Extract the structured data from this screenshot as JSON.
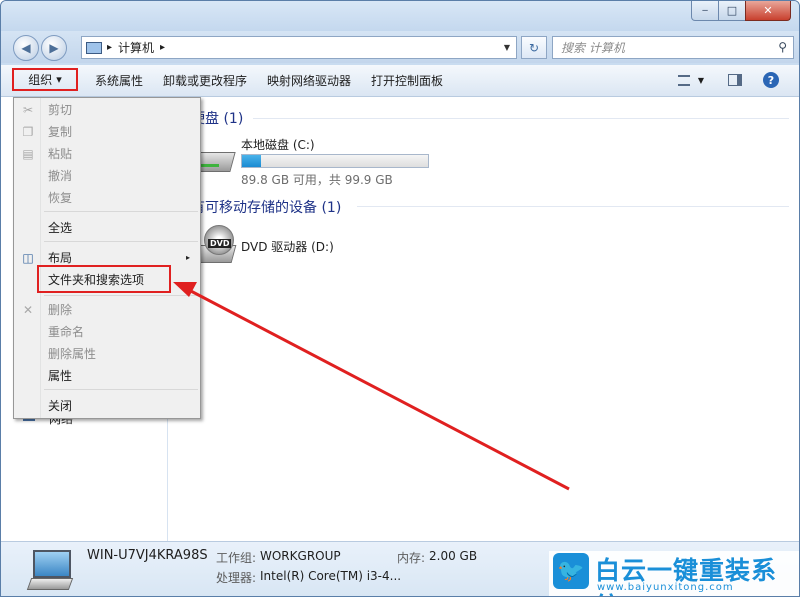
{
  "window": {
    "caption_buttons": {
      "minimize": "‒",
      "maximize": "□",
      "close": "✕"
    }
  },
  "nav": {
    "back": "◀",
    "forward": "▶",
    "address_sep1": "▸",
    "address_text": "计算机",
    "address_sep2": "▸",
    "refresh": "↻",
    "search_placeholder": "搜索 计算机"
  },
  "toolbar": {
    "organize": "组织",
    "organize_caret": "▾",
    "items": [
      "系统属性",
      "卸载或更改程序",
      "映射网络驱动器",
      "打开控制面板"
    ],
    "help": "?"
  },
  "content": {
    "group_hard": "硬盘 (1)",
    "drive_c": {
      "name": "本地磁盘 (C:)",
      "usage_text": "89.8 GB 可用，共 99.9 GB",
      "used_fraction": 0.1
    },
    "group_removable": "有可移动存储的设备 (1)",
    "drive_d": {
      "name": "DVD 驱动器 (D:)",
      "badge": "DVD"
    }
  },
  "menu": {
    "cut": "剪切",
    "copy": "复制",
    "paste": "粘贴",
    "undo": "撤消",
    "redo": "恢复",
    "select_all": "全选",
    "layout": "布局",
    "folder_options": "文件夹和搜索选项",
    "delete": "删除",
    "rename": "重命名",
    "remove_props": "删除属性",
    "properties": "属性",
    "close": "关闭",
    "submenu_arrow": "▸"
  },
  "navpane": {
    "partial_label": "网络"
  },
  "details": {
    "computer_name": "WIN-U7VJ4KRA98S",
    "workgroup_label": "工作组:",
    "workgroup_value": "WORKGROUP",
    "memory_label": "内存:",
    "memory_value": "2.00 GB",
    "cpu_label": "处理器:",
    "cpu_value": "Intel(R) Core(TM) i3-4..."
  },
  "watermark": {
    "brand": "白云一键重装系统",
    "url": "www.baiyunxitong.com",
    "logo": "🐦"
  },
  "colors": {
    "annotation": "#e02020",
    "accent": "#1a8fd8",
    "group_heading": "#1e3287"
  }
}
